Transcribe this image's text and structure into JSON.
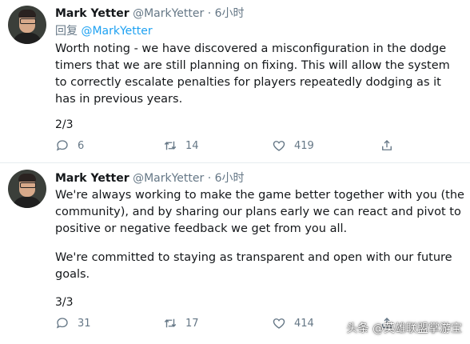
{
  "tweets": [
    {
      "author": "Mark Yetter",
      "handle": "@MarkYetter",
      "separator": "·",
      "time": "6小时",
      "reply_prefix": "回复",
      "reply_to": "@MarkYetter",
      "paragraphs": [
        "Worth noting - we have discovered a misconfiguration in the dodge timers that we are still planning on fixing. This will allow the system to correctly escalate penalties for players repeatedly dodging as it has in previous years."
      ],
      "thread_count": "2/3",
      "replies": "6",
      "retweets": "14",
      "likes": "419"
    },
    {
      "author": "Mark Yetter",
      "handle": "@MarkYetter",
      "separator": "·",
      "time": "6小时",
      "paragraphs": [
        "We're always working to make the game better together with you (the community), and by sharing our plans early we can react and pivot to positive or negative feedback we get from you all.",
        "We're committed to staying as transparent and open with our future goals."
      ],
      "thread_count": "3/3",
      "replies": "31",
      "retweets": "17",
      "likes": "414"
    }
  ],
  "watermark": "头条 @英雄联盟掌游宝",
  "icons": {
    "reply": "reply-icon",
    "retweet": "retweet-icon",
    "like": "heart-icon",
    "share": "share-icon"
  },
  "colors": {
    "link": "#1da1f2",
    "secondary_text": "#657786",
    "divider": "#e6ecf0"
  }
}
